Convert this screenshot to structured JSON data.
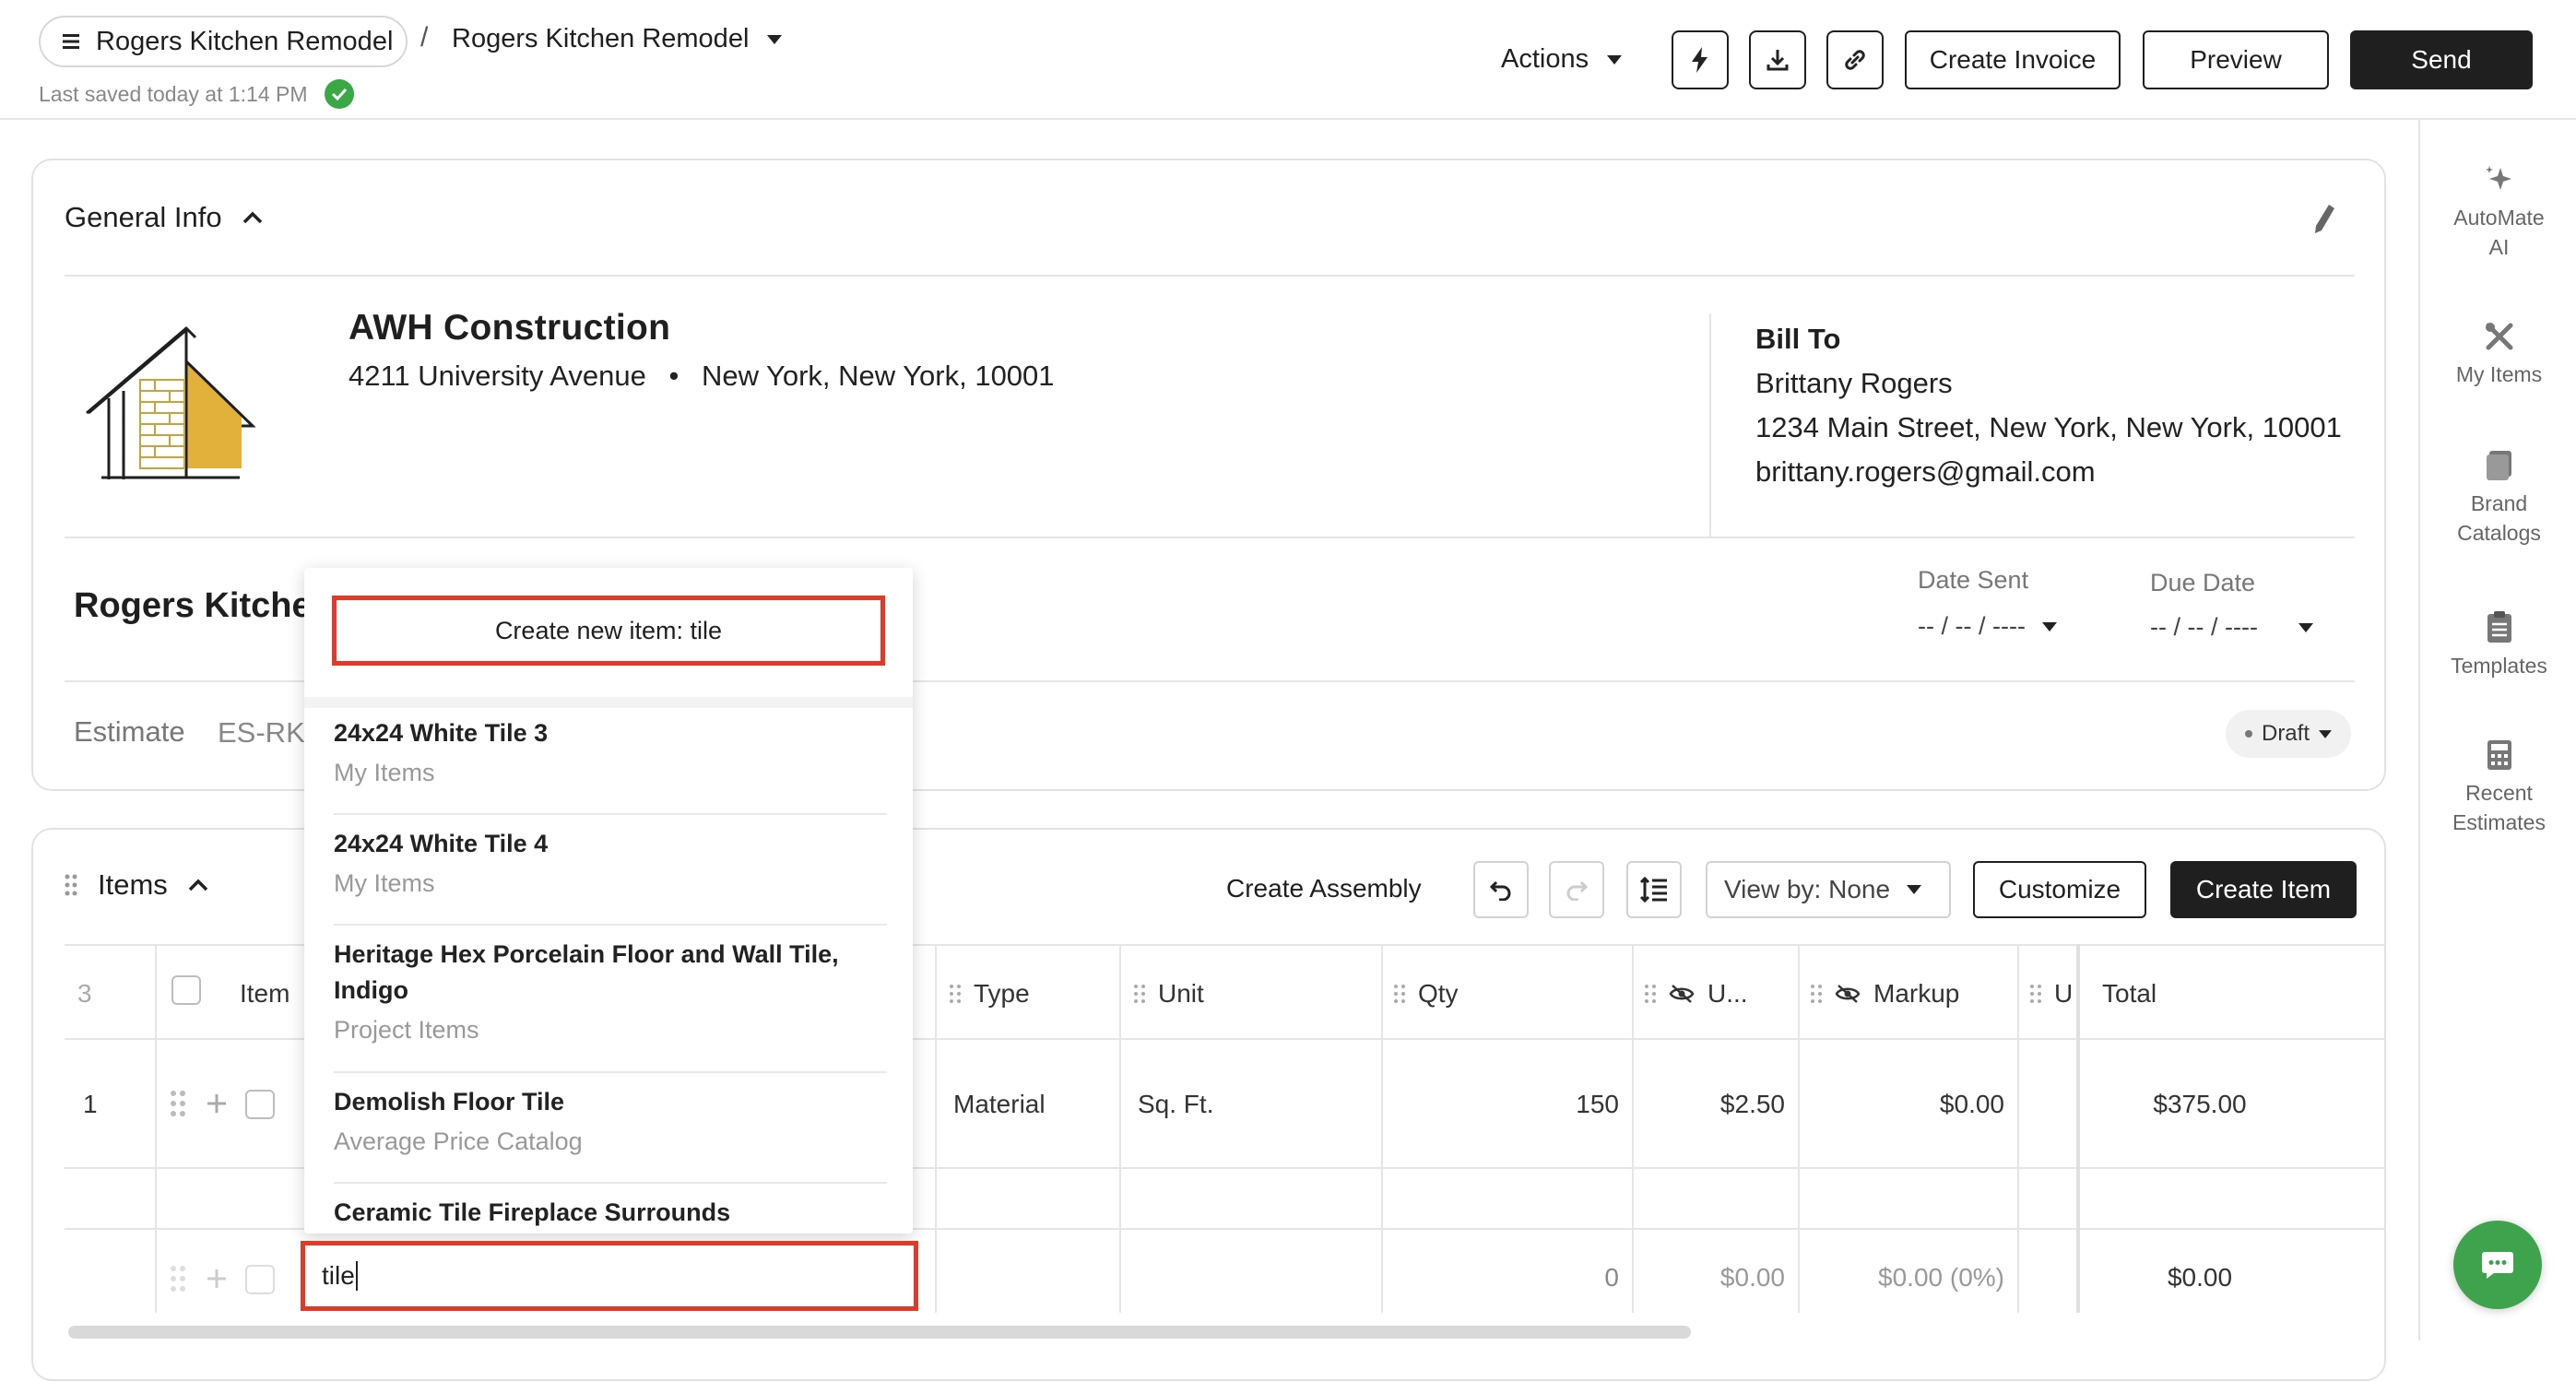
{
  "header": {
    "breadcrumb_root": "Rogers Kitchen Remodel",
    "breadcrumb_sep": "/",
    "breadcrumb_current": "Rogers Kitchen Remodel",
    "saved_text": "Last saved today at 1:14 PM",
    "actions_label": "Actions",
    "create_invoice": "Create Invoice",
    "preview": "Preview",
    "send": "Send"
  },
  "rail": [
    {
      "label_1": "AutoMate",
      "label_2": "AI",
      "icon": "sparkle-icon"
    },
    {
      "label_1": "My Items",
      "label_2": "",
      "icon": "tools-icon"
    },
    {
      "label_1": "Brand",
      "label_2": "Catalogs",
      "icon": "catalog-icon"
    },
    {
      "label_1": "Templates",
      "label_2": "",
      "icon": "clipboard-icon"
    },
    {
      "label_1": "Recent",
      "label_2": "Estimates",
      "icon": "calculator-icon"
    }
  ],
  "general_info": {
    "title": "General Info",
    "company_name": "AWH Construction",
    "company_street": "4211 University Avenue",
    "company_bullet": "•",
    "company_city": "New York, New York, 10001",
    "bill_to_label": "Bill To",
    "bill_to_name": "Brittany Rogers",
    "bill_to_address": "1234 Main Street, New York, New York, 10001",
    "bill_to_email": "brittany.rogers@gmail.com",
    "project_title": "Rogers Kitche",
    "date_sent_label": "Date Sent",
    "date_sent_value": "-- / -- / ----",
    "due_date_label": "Due Date",
    "due_date_value": "-- / -- / ----",
    "estimate_label": "Estimate",
    "estimate_number": "ES-RK",
    "status": "Draft"
  },
  "items_section": {
    "title": "Items",
    "create_assembly": "Create Assembly",
    "view_by": "View by: None",
    "customize": "Customize",
    "create_item": "Create Item",
    "columns": {
      "count": "3",
      "item": "Item",
      "type": "Type",
      "unit": "Unit",
      "qty": "Qty",
      "unit_cost": "U...",
      "markup": "Markup",
      "extra": "U",
      "total": "Total"
    },
    "rows": [
      {
        "num": "1",
        "type": "Material",
        "unit": "Sq. Ft.",
        "qty": "150",
        "unit_cost": "$2.50",
        "markup": "$0.00",
        "total": "$375.00"
      },
      {
        "num": "",
        "type": "",
        "unit": "",
        "qty": "0",
        "unit_cost": "$0.00",
        "markup": "$0.00 (0%)",
        "total": "$0.00"
      }
    ]
  },
  "dropdown": {
    "create_new": "Create new item: tile",
    "items": [
      {
        "name": "24x24 White Tile 3",
        "source": "My Items"
      },
      {
        "name": "24x24 White Tile 4",
        "source": "My Items"
      },
      {
        "name": "Heritage Hex Porcelain Floor and Wall Tile, Indigo",
        "source": "Project Items"
      },
      {
        "name": "Demolish Floor Tile",
        "source": "Average Price Catalog"
      },
      {
        "name": "Ceramic Tile Fireplace Surrounds",
        "source": ""
      }
    ]
  },
  "search": {
    "value": "tile"
  },
  "colors": {
    "accent_red": "#e03a28",
    "success_green": "#39a845",
    "chat_green": "#3fa34d",
    "dark": "#1f1f1f",
    "logo_yellow": "#e2b13c"
  }
}
